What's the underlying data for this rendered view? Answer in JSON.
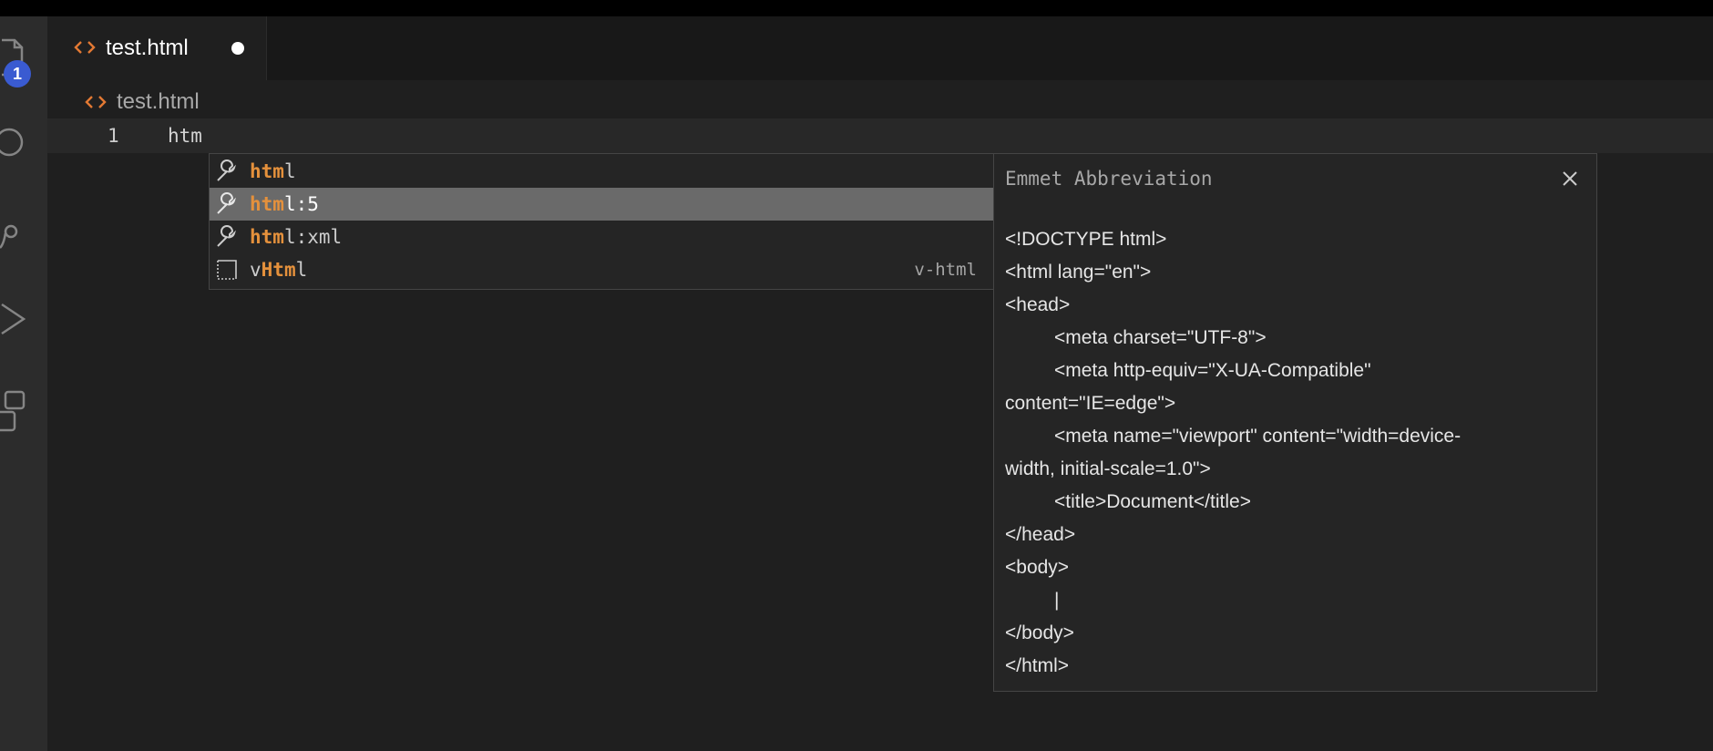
{
  "tab": {
    "label": "test.html",
    "icon": "code-icon",
    "unsaved": true
  },
  "breadcrumb": {
    "label": "test.html",
    "icon": "code-icon"
  },
  "activity_bar": {
    "items": [
      "explorer-icon",
      "search-icon",
      "source-control-icon",
      "run-debug-icon",
      "extensions-icon"
    ],
    "explorer_badge": "1"
  },
  "editor": {
    "line_number": "1",
    "code": "htm"
  },
  "suggestions": [
    {
      "match": "htm",
      "rest": "l",
      "icon": "wrench-icon",
      "selected": false,
      "detail": ""
    },
    {
      "match": "htm",
      "rest": "l:5",
      "icon": "wrench-icon",
      "selected": true,
      "detail": ""
    },
    {
      "match": "htm",
      "rest": "l:xml",
      "icon": "wrench-icon",
      "selected": false,
      "detail": ""
    },
    {
      "pre": "v",
      "match": "Htm",
      "rest": "l",
      "icon": "snippet-icon",
      "selected": false,
      "detail": "v-html"
    }
  ],
  "details": {
    "title": "Emmet Abbreviation",
    "lines": [
      "<!DOCTYPE html>",
      "<html lang=\"en\">",
      "<head>",
      "<meta charset=\"UTF-8\">",
      "<meta http-equiv=\"X-UA-Compatible\"",
      "content=\"IE=edge\">",
      "<meta name=\"viewport\" content=\"width=device-",
      "width, initial-scale=1.0\">",
      "<title>Document</title>",
      "</head>",
      "<body>",
      "|",
      "</body>",
      "</html>"
    ]
  },
  "colors": {
    "accent": "#e37933",
    "match": "#e5913c",
    "badge": "#3a5bd1",
    "selection": "#6a6a6a"
  }
}
